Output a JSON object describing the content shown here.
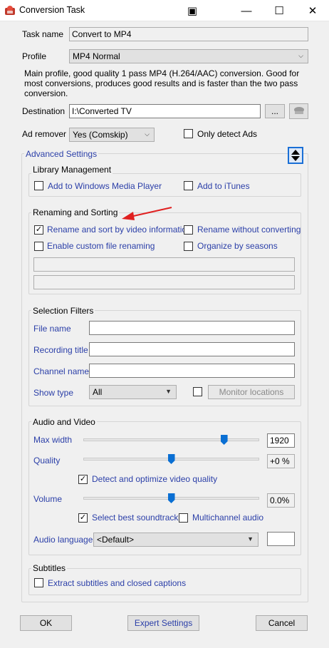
{
  "window": {
    "title": "Conversion Task",
    "app_icon": "app-icon",
    "controls": {
      "snap": "▣",
      "minimize": "—",
      "maximize": "☐",
      "close": "✕"
    }
  },
  "task_name": {
    "label": "Task name",
    "value": "Convert to MP4"
  },
  "profile": {
    "label": "Profile",
    "value": "MP4 Normal",
    "description": "Main profile, good quality 1 pass MP4 (H.264/AAC) conversion. Good for most conversions, produces good results and is faster than the two pass conversion."
  },
  "destination": {
    "label": "Destination",
    "value": "I:\\Converted TV",
    "browse_label": "..."
  },
  "ad_remover": {
    "label": "Ad remover",
    "value": "Yes (Comskip)",
    "only_detect_label": "Only detect Ads",
    "only_detect_checked": false
  },
  "advanced": {
    "label": "Advanced Settings"
  },
  "library": {
    "title": "Library Management",
    "wmp_label": "Add to Windows Media Player",
    "wmp_checked": false,
    "itunes_label": "Add to iTunes",
    "itunes_checked": false
  },
  "renaming": {
    "title": "Renaming and Sorting",
    "rename_sort_label": "Rename and sort by video information",
    "rename_sort_checked": true,
    "rename_without_label": "Rename without converting",
    "rename_without_checked": false,
    "custom_label": "Enable custom file renaming",
    "custom_checked": false,
    "seasons_label": "Organize by seasons",
    "seasons_checked": false
  },
  "filters": {
    "title": "Selection Filters",
    "file_name_label": "File name",
    "recording_title_label": "Recording title",
    "channel_name_label": "Channel name",
    "show_type_label": "Show type",
    "show_type_value": "All",
    "monitor_label": "Monitor locations"
  },
  "audio_video": {
    "title": "Audio and Video",
    "max_width_label": "Max width",
    "max_width_value": "1920",
    "max_width_level": 0.8,
    "quality_label": "Quality",
    "quality_value": "+0 %",
    "quality_level": 0.5,
    "detect_label": "Detect and optimize video quality",
    "detect_checked": true,
    "volume_label": "Volume",
    "volume_value": "0.0%",
    "volume_level": 0.5,
    "soundtrack_label": "Select best soundtrack",
    "soundtrack_checked": true,
    "multichannel_label": "Multichannel audio",
    "multichannel_checked": false,
    "audio_language_label": "Audio language",
    "audio_language_value": "<Default>"
  },
  "subtitles": {
    "title": "Subtitles",
    "extract_label": "Extract subtitles and closed captions",
    "extract_checked": false
  },
  "buttons": {
    "ok": "OK",
    "expert": "Expert Settings",
    "cancel": "Cancel"
  },
  "colors": {
    "link_blue": "#2b3fa8",
    "annotation_arrow": "#e02020",
    "slider_thumb": "#0a6fd3"
  }
}
